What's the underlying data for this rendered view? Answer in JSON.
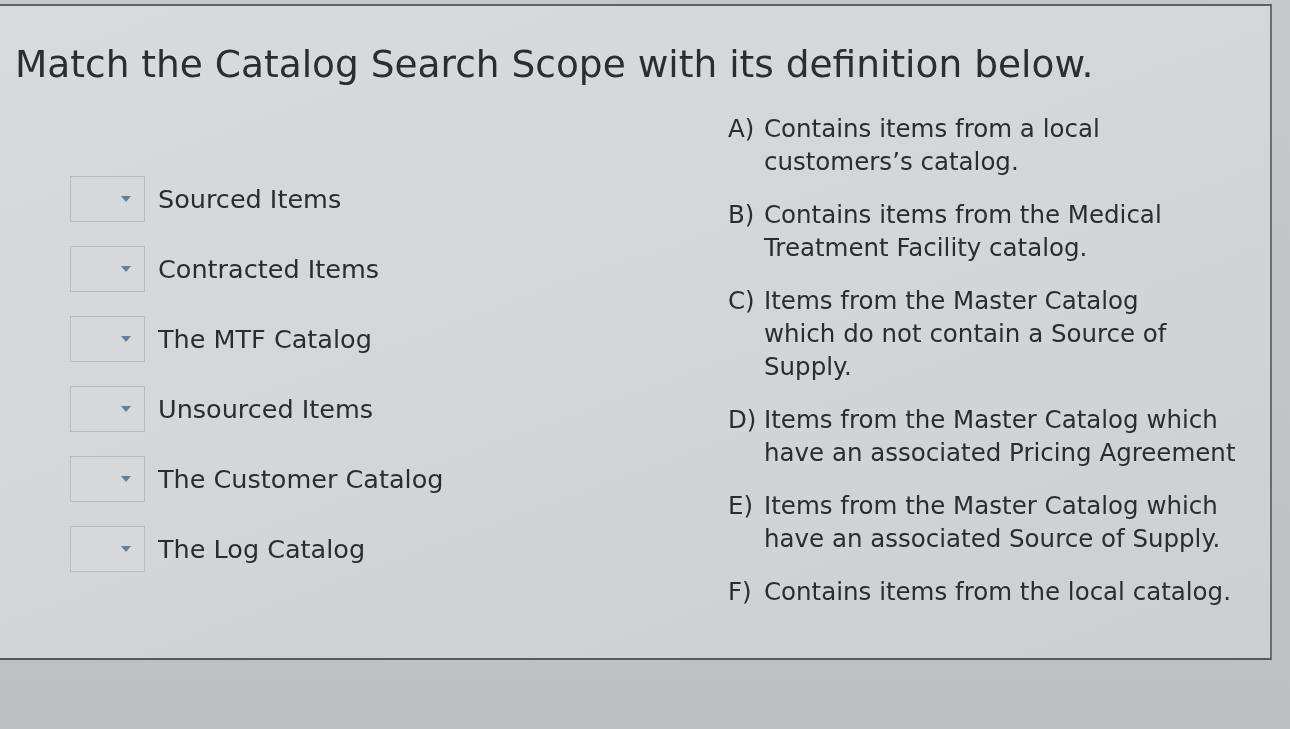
{
  "question": {
    "prompt": "Match the Catalog Search Scope with its definition below."
  },
  "terms": [
    {
      "label": "Sourced Items"
    },
    {
      "label": "Contracted Items"
    },
    {
      "label": "The MTF Catalog"
    },
    {
      "label": "Unsourced Items"
    },
    {
      "label": "The Customer Catalog"
    },
    {
      "label": "The Log Catalog"
    }
  ],
  "definitions": [
    {
      "letter": "A)",
      "text": "Contains items from a local\ncustomers’s catalog."
    },
    {
      "letter": "B)",
      "text": "Contains items from the Medical\nTreatment Facility catalog."
    },
    {
      "letter": "C)",
      "text": "Items from the Master Catalog\nwhich do not contain a Source of\nSupply."
    },
    {
      "letter": "D)",
      "text": "Items from the Master Catalog which\nhave an associated Pricing Agreement"
    },
    {
      "letter": "E)",
      "text": "Items from the Master Catalog which\nhave an associated Source of Supply."
    },
    {
      "letter": "F)",
      "text": "Contains items from the local catalog."
    }
  ]
}
